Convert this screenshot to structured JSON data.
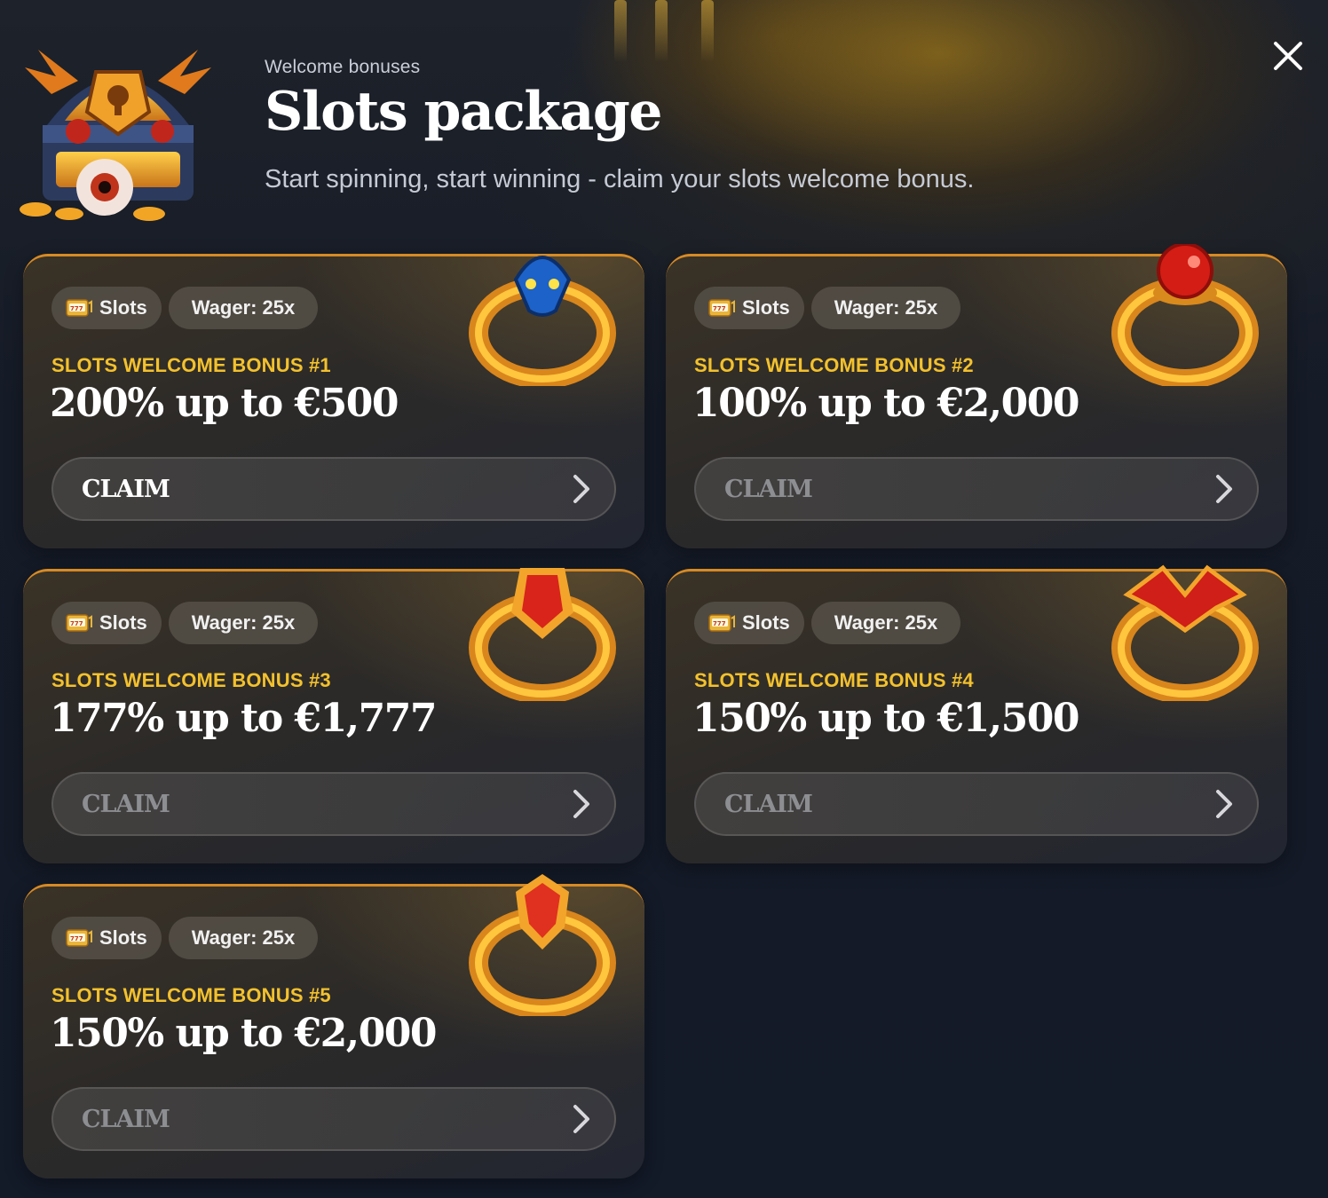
{
  "header": {
    "subtitle": "Welcome bonuses",
    "title": "Slots package",
    "description": "Start spinning, start winning - claim your slots welcome bonus."
  },
  "icons": {
    "close": "close-icon",
    "chest": "treasure-chest-icon",
    "slots": "slot-machine-icon",
    "chevron": "chevron-right-icon"
  },
  "colors": {
    "accent": "#f3c12d",
    "card_border": "#d78a24",
    "background": "#141a26"
  },
  "bonuses": [
    {
      "tag_type": "Slots",
      "wager": "Wager: 25x",
      "label": "SLOTS WELCOME BONUS #1",
      "amount": "200% up to €500",
      "claim": "CLAIM",
      "icon": "demon-ring-icon"
    },
    {
      "tag_type": "Slots",
      "wager": "Wager: 25x",
      "label": "SLOTS WELCOME BONUS #2",
      "amount": "100% up to €2,000",
      "claim": "CLAIM",
      "icon": "ruby-orb-ring-icon"
    },
    {
      "tag_type": "Slots",
      "wager": "Wager: 25x",
      "label": "SLOTS WELCOME BONUS #3",
      "amount": "177% up to €1,777",
      "claim": "CLAIM",
      "icon": "red-crystal-ring-icon"
    },
    {
      "tag_type": "Slots",
      "wager": "Wager: 25x",
      "label": "SLOTS WELCOME BONUS #4",
      "amount": "150% up to €1,500",
      "claim": "CLAIM",
      "icon": "bat-wing-ring-icon"
    },
    {
      "tag_type": "Slots",
      "wager": "Wager: 25x",
      "label": "SLOTS WELCOME BONUS #5",
      "amount": "150% up to €2,000",
      "claim": "CLAIM",
      "icon": "red-gem-ring-icon"
    }
  ]
}
